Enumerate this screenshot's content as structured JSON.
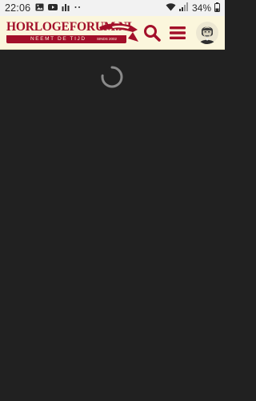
{
  "status_bar": {
    "time": "22:06",
    "battery_percent": "34%",
    "left_icons": [
      "image-icon",
      "youtube-icon",
      "bar-chart-icon",
      "more-dots-icon"
    ],
    "right_icons": [
      "wifi-icon",
      "signal-icon",
      "battery-icon"
    ]
  },
  "header": {
    "logo": {
      "name": "HORLOGEFORUM.NL",
      "tagline": "NEEMT DE TIJD",
      "since": "SINDS 2002"
    },
    "icons": [
      "search-icon",
      "menu-icon",
      "avatar"
    ],
    "accent_color": "#a3102a",
    "background_color": "#fbf6dc"
  },
  "content": {
    "state": "loading",
    "background_color": "#212121"
  }
}
